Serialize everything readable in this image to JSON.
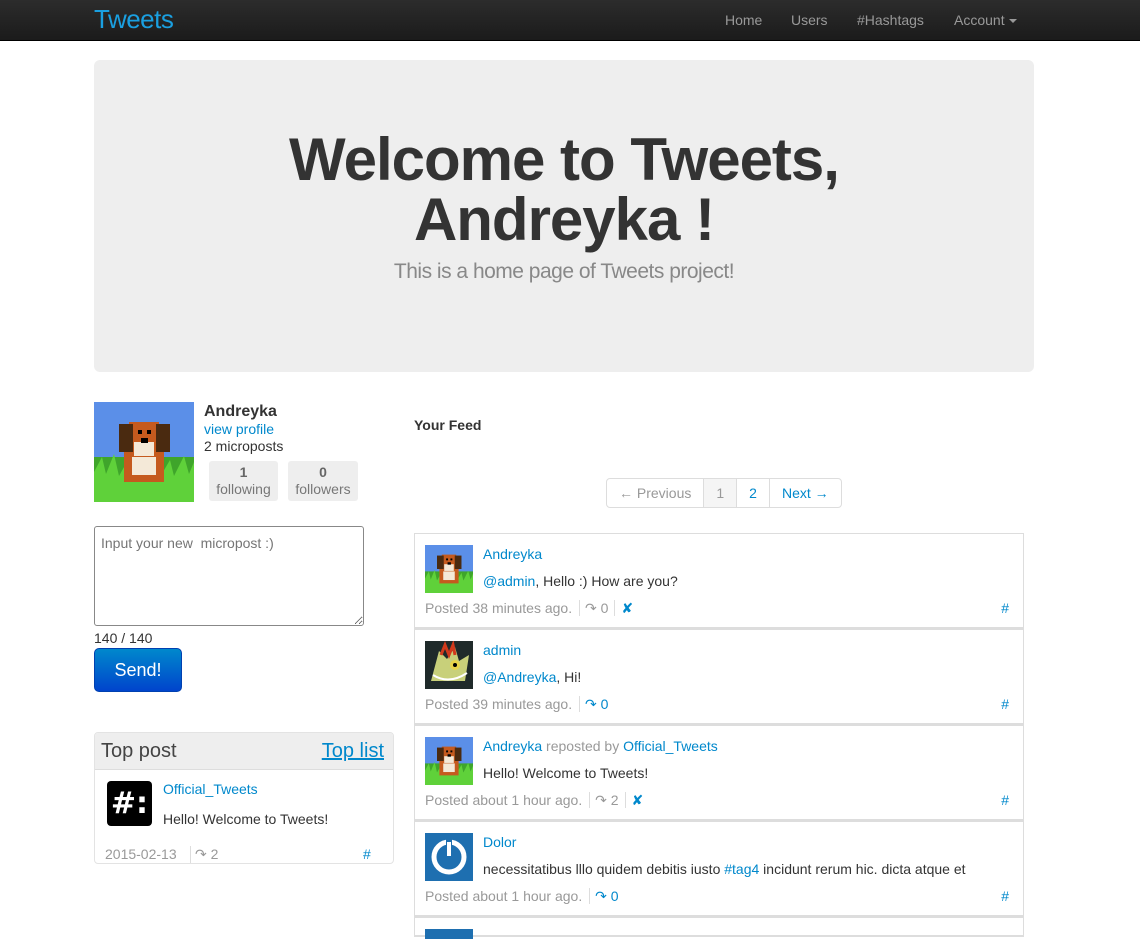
{
  "nav": {
    "brand": "Tweets",
    "items": [
      "Home",
      "Users",
      "#Hashtags",
      "Account"
    ]
  },
  "hero": {
    "title_line1": "Welcome to Tweets,",
    "title_line2": "Andreyka !",
    "subtitle": "This is a home page of Tweets project!"
  },
  "profile": {
    "name": "Andreyka",
    "view_profile": "view profile",
    "microposts": "2 microposts",
    "following_count": "1",
    "following_label": "following",
    "followers_count": "0",
    "followers_label": "followers"
  },
  "compose": {
    "placeholder": "Input your new  micropost :)",
    "counter": "140 / 140",
    "send": "Send!"
  },
  "top_post": {
    "title": "Top post",
    "top_list": "Top list",
    "avatar_text": "#:",
    "author": "Official_Tweets",
    "text": "Hello! Welcome to Tweets!",
    "date": "2015-02-13",
    "reposts": "↷ 2",
    "hash": "#"
  },
  "feed": {
    "title": "Your Feed",
    "pager": {
      "previous": "← Previous",
      "pages": [
        "1",
        "2"
      ],
      "next": "Next →"
    },
    "posts": [
      {
        "author": "Andreyka",
        "mention": "@admin",
        "text": ", Hello :) How are you?",
        "posted": "Posted 38 minutes ago.",
        "reposts": "↷ 0",
        "delete": "✘",
        "hash": "#"
      },
      {
        "author": "admin",
        "mention": "@Andreyka",
        "text": ", Hi!",
        "posted": "Posted 39 minutes ago.",
        "reposts": "↷ 0",
        "hash": "#"
      },
      {
        "author": "Andreyka",
        "reposted_by_label": " reposted by ",
        "reposted_by": "Official_Tweets",
        "text": "Hello! Welcome to Tweets!",
        "posted": "Posted about 1 hour ago.",
        "reposts": "↷ 2",
        "delete": "✘",
        "hash": "#"
      },
      {
        "author": "Dolor",
        "text_before": "necessitatibus lllo quidem debitis iusto ",
        "tag": "#tag4",
        "text_after": " incidunt rerum hic. dicta atque et",
        "posted": "Posted about 1 hour ago.",
        "reposts": "↷ 0",
        "hash": "#"
      }
    ]
  }
}
